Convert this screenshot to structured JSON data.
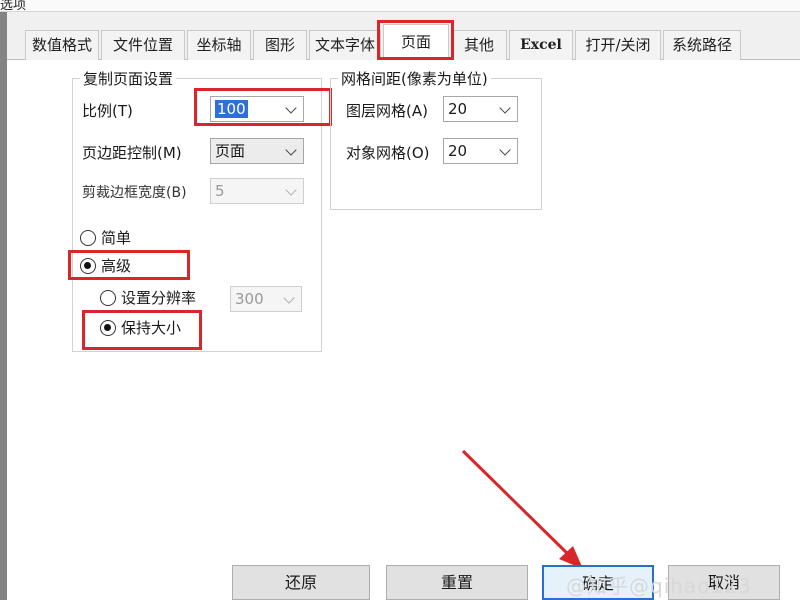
{
  "window": {
    "title_fragment": "选项"
  },
  "tabs": [
    {
      "label": "数值格式"
    },
    {
      "label": "文件位置"
    },
    {
      "label": "坐标轴"
    },
    {
      "label": "图形"
    },
    {
      "label": "文本字体"
    },
    {
      "label": "页面"
    },
    {
      "label": "其他"
    },
    {
      "label": "Excel"
    },
    {
      "label": "打开/关闭"
    },
    {
      "label": "系统路径"
    }
  ],
  "active_tab": "页面",
  "copy_settings": {
    "legend": "复制页面设置",
    "scale_label": "比例(T)",
    "scale_value": "100",
    "margin_label": "页边距控制(M)",
    "margin_value": "页面",
    "crop_label": "剪裁边框宽度(B)",
    "crop_value": "5",
    "simple_label": "简单",
    "simple_selected": false,
    "advanced_label": "高级",
    "advanced_selected": true,
    "resolution_label": "设置分辨率",
    "resolution_selected": false,
    "resolution_value": "300",
    "keep_size_label": "保持大小",
    "keep_size_selected": true
  },
  "grid_spacing": {
    "legend": "网格间距(像素为单位)",
    "layer_label": "图层网格(A)",
    "layer_value": "20",
    "object_label": "对象网格(O)",
    "object_value": "20"
  },
  "buttons": {
    "restore": "还原",
    "reset": "重置",
    "ok": "确定",
    "cancel": "取消"
  },
  "watermark": "@知乎@qihao123",
  "colors": {
    "highlight": "#d9262b",
    "selection": "#2f6fd6",
    "primary_border": "#2a6fd0"
  }
}
